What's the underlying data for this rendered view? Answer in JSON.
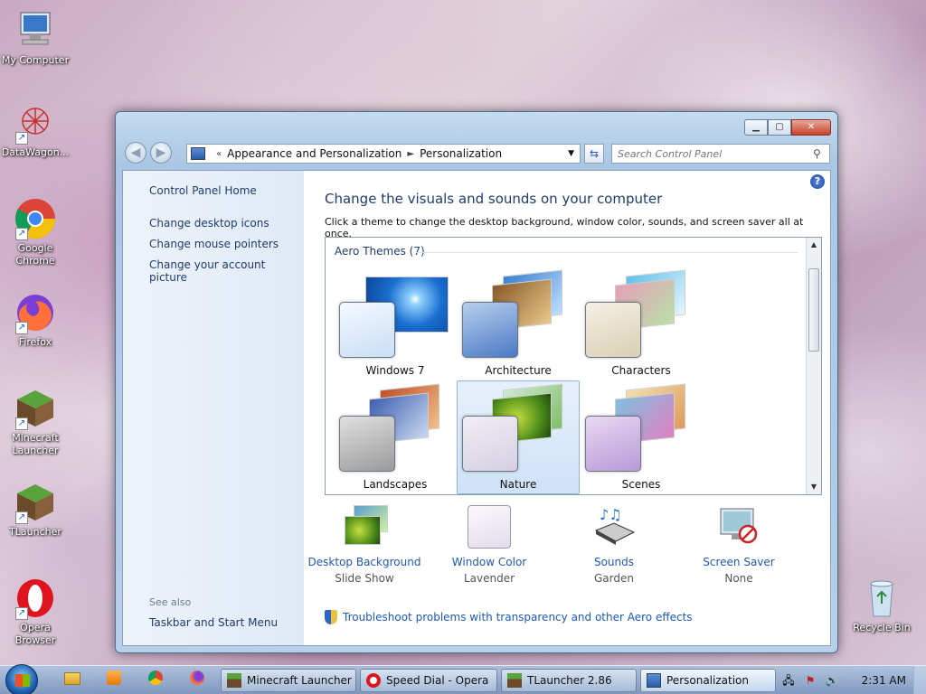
{
  "desktop": {
    "icons": [
      {
        "label": "My Computer"
      },
      {
        "label": "DataWagon..."
      },
      {
        "label": "Google Chrome"
      },
      {
        "label": "Firefox"
      },
      {
        "label": "Minecraft Launcher"
      },
      {
        "label": "TLauncher"
      },
      {
        "label": "Opera Browser"
      },
      {
        "label": "Recycle Bin"
      }
    ]
  },
  "window": {
    "address": {
      "back_glyph": "«",
      "crumb1": "Appearance and Personalization",
      "sep": "►",
      "crumb2": "Personalization"
    },
    "search_placeholder": "Search Control Panel",
    "sidebar": {
      "home": "Control Panel Home",
      "links": [
        "Change desktop icons",
        "Change mouse pointers",
        "Change your account picture"
      ],
      "see_also": "See also",
      "see_also_link": "Taskbar and Start Menu"
    },
    "heading": "Change the visuals and sounds on your computer",
    "subtitle": "Click a theme to change the desktop background, window color, sounds, and screen saver all at once.",
    "group_title": "Aero Themes (7)",
    "themes": [
      "Windows 7",
      "Architecture",
      "Characters",
      "Landscapes",
      "Nature",
      "Scenes"
    ],
    "selected_theme": "Nature",
    "settings": [
      {
        "label": "Desktop Background",
        "value": "Slide Show"
      },
      {
        "label": "Window Color",
        "value": "Lavender"
      },
      {
        "label": "Sounds",
        "value": "Garden"
      },
      {
        "label": "Screen Saver",
        "value": "None"
      }
    ],
    "troubleshoot": "Troubleshoot problems with transparency and other Aero effects"
  },
  "taskbar": {
    "tasks": [
      "Minecraft Launcher",
      "Speed Dial - Opera",
      "TLauncher 2.86",
      "Personalization"
    ],
    "active_task": "Personalization",
    "clock": "2:31 AM"
  }
}
